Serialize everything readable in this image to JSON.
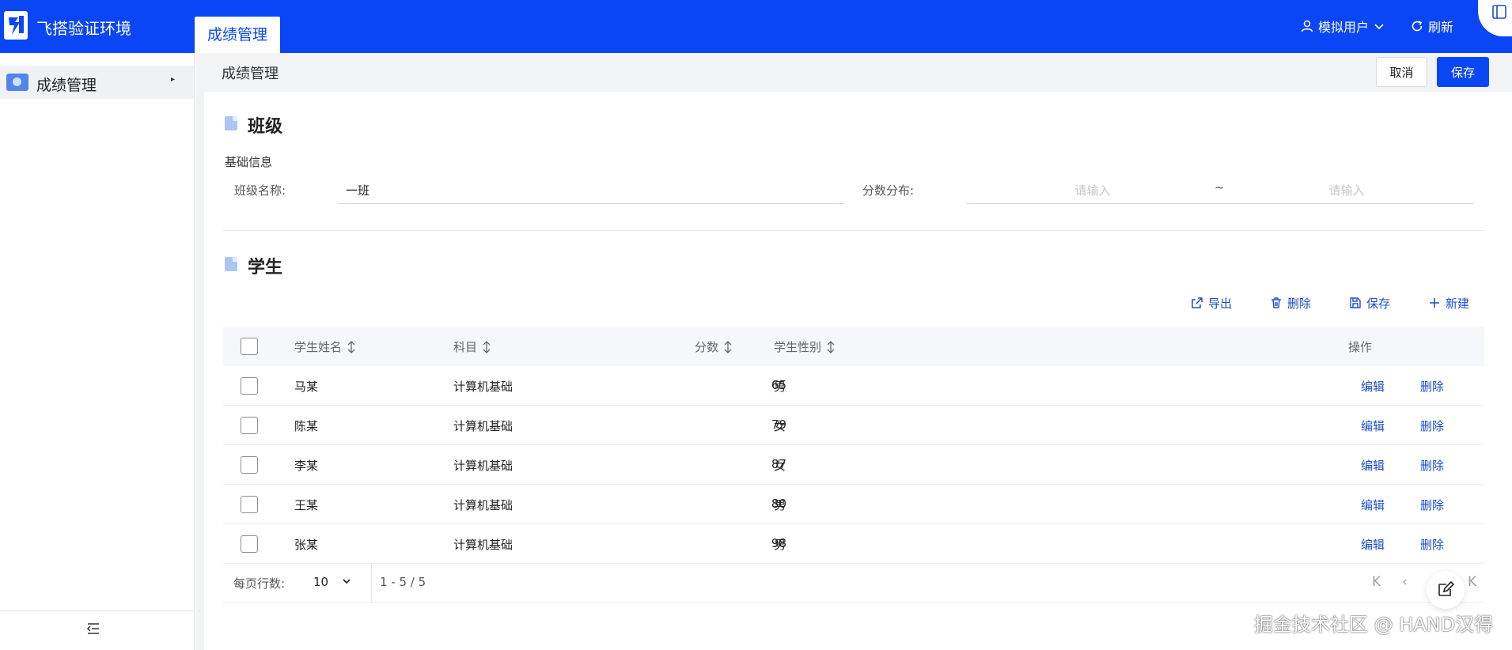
{
  "app": {
    "title": "飞搭验证环境"
  },
  "top_tab": {
    "label": "成绩管理"
  },
  "user_menu": {
    "label": "模拟用户"
  },
  "refresh": {
    "label": "刷新"
  },
  "sidebar": {
    "items": [
      {
        "label": "成绩管理",
        "icon": "monitor-icon"
      }
    ]
  },
  "page": {
    "breadcrumb": "成绩管理",
    "cancel_label": "取消",
    "save_label": "保存"
  },
  "class_section": {
    "title": "班级",
    "subtitle": "基础信息",
    "name_label": "班级名称:",
    "name_value": "一班",
    "score_label": "分数分布:",
    "score_from_placeholder": "请输入",
    "score_to_placeholder": "请输入",
    "range_separator": "~"
  },
  "student_section": {
    "title": "学生",
    "toolbar": {
      "export": "导出",
      "delete": "删除",
      "save": "保存",
      "new": "新建"
    },
    "columns": [
      "学生姓名",
      "科目",
      "分数",
      "学生性别",
      "操作"
    ],
    "rows": [
      {
        "name": "马某",
        "subject": "计算机基础",
        "score": "65",
        "gender": "男",
        "edit": "编辑",
        "delete": "删除"
      },
      {
        "name": "陈某",
        "subject": "计算机基础",
        "score": "79",
        "gender": "女",
        "edit": "编辑",
        "delete": "删除"
      },
      {
        "name": "李某",
        "subject": "计算机基础",
        "score": "87",
        "gender": "女",
        "edit": "编辑",
        "delete": "删除"
      },
      {
        "name": "王某",
        "subject": "计算机基础",
        "score": "80",
        "gender": "男",
        "edit": "编辑",
        "delete": "删除"
      },
      {
        "name": "张某",
        "subject": "计算机基础",
        "score": "98",
        "gender": "男",
        "edit": "编辑",
        "delete": "删除"
      }
    ],
    "pagination": {
      "rows_per_page_label": "每页行数:",
      "rows_per_page": "10",
      "range": "1 - 5 / 5"
    }
  },
  "watermark": "掘金技术社区 @ HAND汉得",
  "colors": {
    "primary": "#0a46f5",
    "link": "#1d4fc7"
  }
}
